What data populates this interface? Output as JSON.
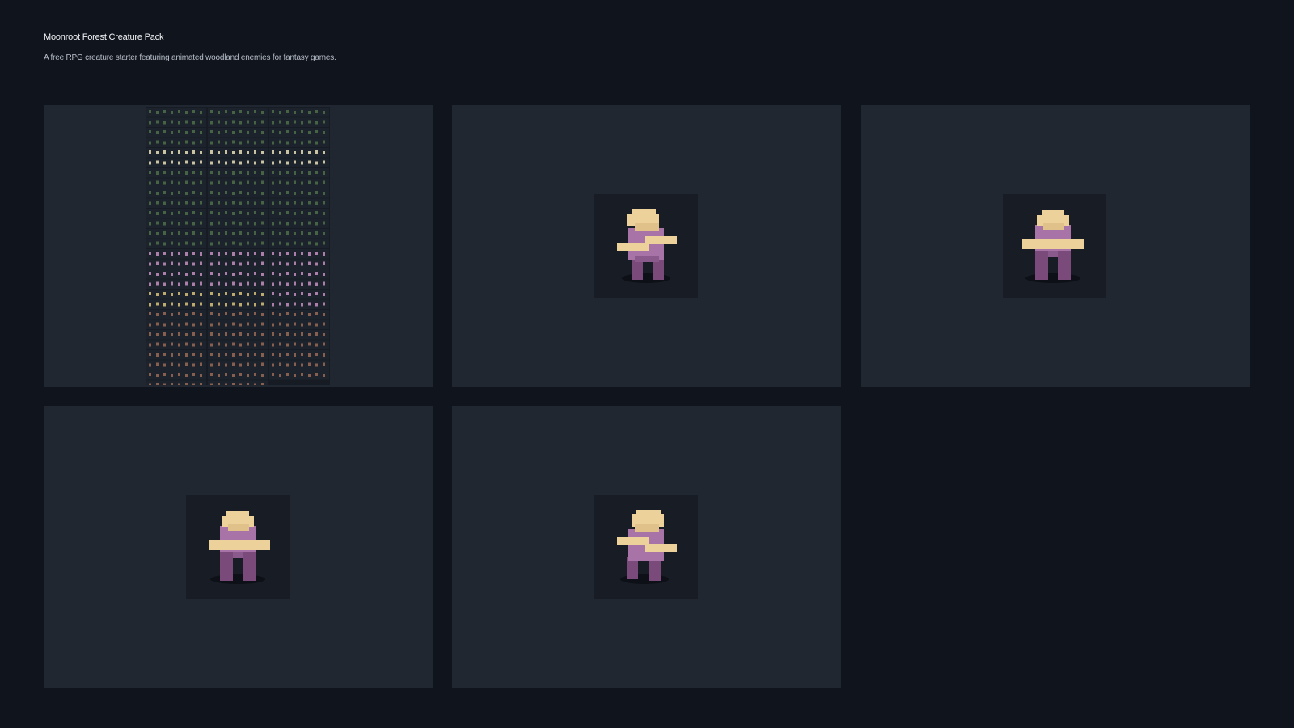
{
  "page": {
    "title": "Moonroot Forest Creature Pack",
    "subtitle": "A free RPG creature starter featuring animated woodland enemies for fantasy games."
  },
  "gallery": {
    "items": [
      {
        "kind": "sprite-sheet",
        "preview_icon": "sprite-sheet-grid"
      },
      {
        "kind": "sprite",
        "preview_icon": "creature-walk-frame-right"
      },
      {
        "kind": "sprite",
        "preview_icon": "creature-idle-front"
      },
      {
        "kind": "sprite",
        "preview_icon": "creature-idle-front"
      },
      {
        "kind": "sprite",
        "preview_icon": "creature-walk-frame-left"
      }
    ]
  },
  "colors": {
    "background": "#10141c",
    "card": "#212731",
    "creature_body": "#a874a8",
    "creature_legs": "#7a4a7a",
    "creature_head": "#ecd29a",
    "sheet_rows": [
      "#4e7048",
      "#e9e1b8",
      "#c48fc0",
      "#d8c27a",
      "#9a6a55"
    ]
  }
}
